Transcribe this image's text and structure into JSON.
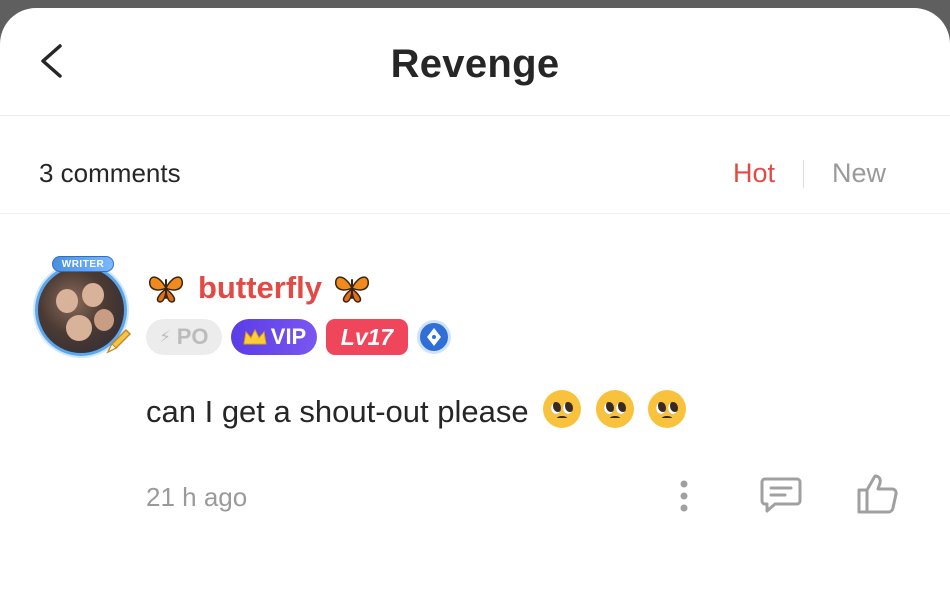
{
  "header": {
    "title": "Revenge"
  },
  "comments_bar": {
    "count_label": "3 comments",
    "sort_hot": "Hot",
    "sort_new": "New"
  },
  "comment": {
    "avatar_tag": "WRITER",
    "username": "butterfly",
    "badges": {
      "po": "PO",
      "vip": "VIP",
      "level": "Lv17"
    },
    "text": "can I get a shout-out please",
    "time": "21 h ago"
  },
  "colors": {
    "accent": "#e24a45",
    "vip": "#5a3de6",
    "level": "#f0465b",
    "muted": "#9a9a9a"
  },
  "icons": [
    "back-chevron-icon",
    "butterfly-icon",
    "crown-icon",
    "pen-icon",
    "more-icon",
    "reply-icon",
    "like-icon"
  ]
}
